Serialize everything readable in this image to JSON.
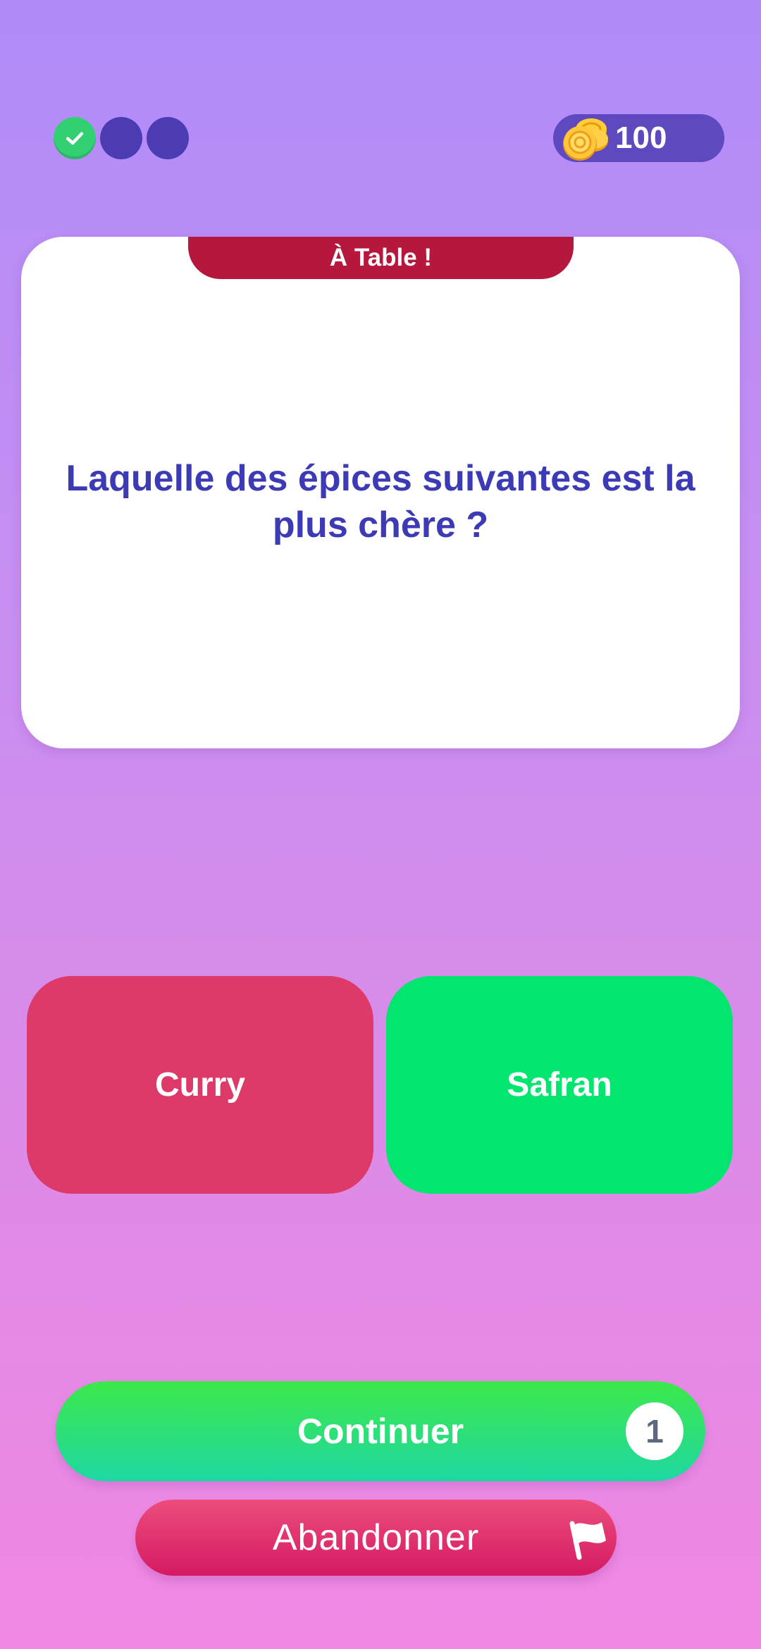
{
  "progress": {
    "steps": [
      {
        "state": "correct",
        "icon": "check-icon"
      },
      {
        "state": "pending"
      },
      {
        "state": "pending"
      }
    ]
  },
  "coins": {
    "icon": "coins-icon",
    "count": "100"
  },
  "card": {
    "category": "À Table !",
    "question": "Laquelle des épices suivantes est la plus chère ?"
  },
  "answers": [
    {
      "label": "Curry",
      "state": "wrong",
      "color": "#de3a69"
    },
    {
      "label": "Safran",
      "state": "correct",
      "color": "#02e56e"
    }
  ],
  "actions": {
    "continue_label": "Continuer",
    "continue_counter": "1",
    "abandon_label": "Abandonner",
    "abandon_icon": "flag-icon"
  },
  "colors": {
    "question_text": "#3c3bb5",
    "category_tab": "#b5173d",
    "progress_pending": "#4b3cb4",
    "progress_done": "#33cf73",
    "coins_badge": "#5e49bf"
  }
}
